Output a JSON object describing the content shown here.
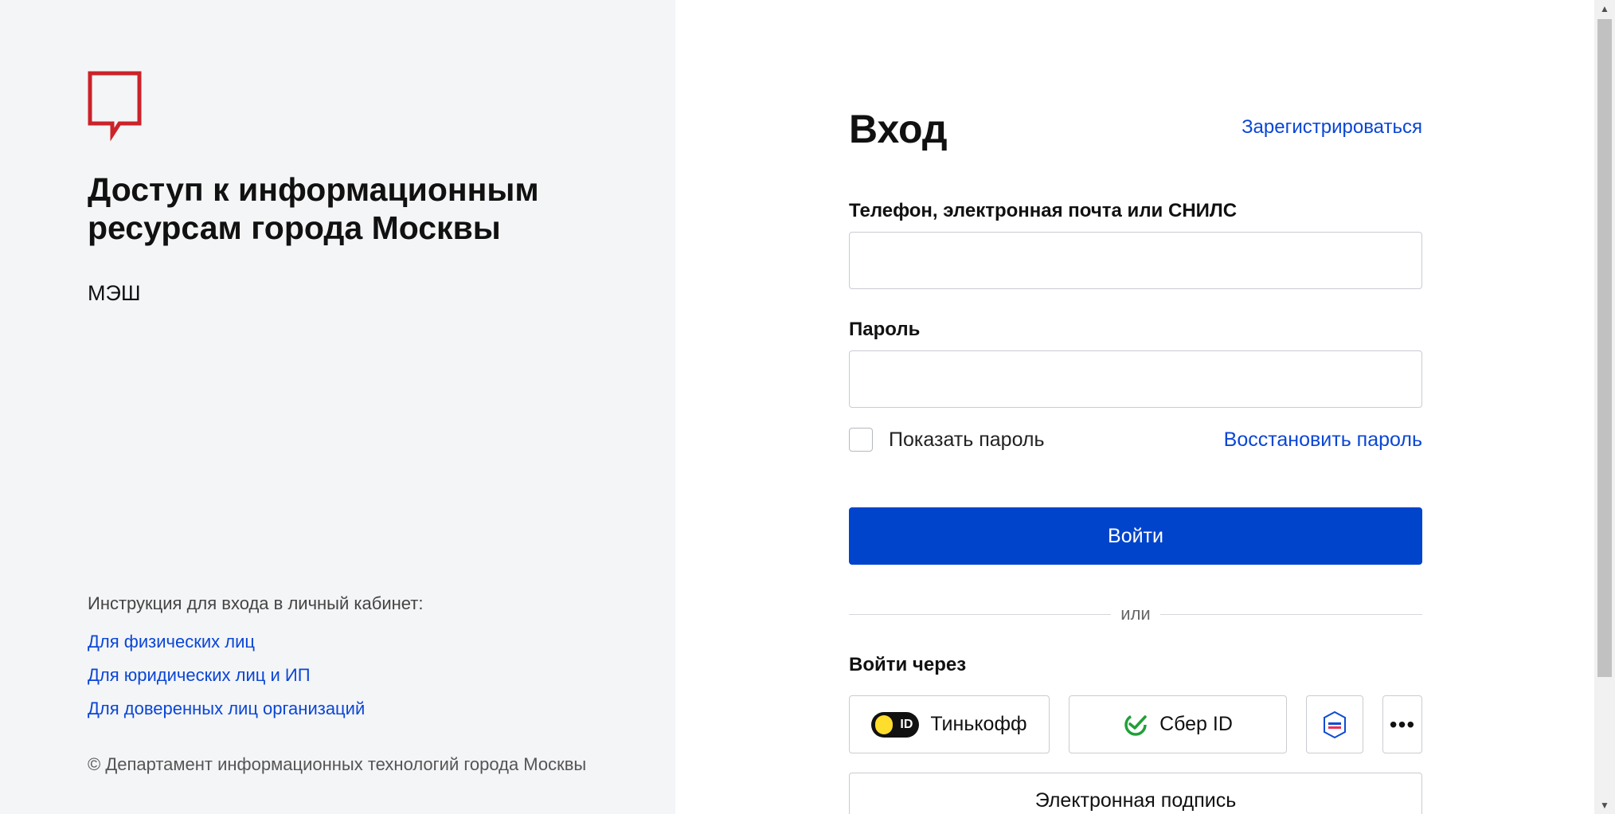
{
  "left_panel": {
    "title": "Доступ к информационным ресурсам города Москвы",
    "service_name": "МЭШ",
    "instructions_title": "Инструкция для входа в личный кабинет:",
    "links": [
      "Для физических лиц",
      "Для юридических лиц и ИП",
      "Для доверенных лиц организаций"
    ],
    "copyright": "© Департамент информационных технологий города Москвы"
  },
  "form": {
    "title": "Вход",
    "register_link": "Зарегистрироваться",
    "login_label": "Телефон, электронная почта или СНИЛС",
    "login_value": "",
    "password_label": "Пароль",
    "password_value": "",
    "show_password_label": "Показать пароль",
    "show_password_checked": false,
    "restore_link": "Восстановить пароль",
    "submit_label": "Войти",
    "divider_text": "или",
    "via_title": "Войти через",
    "providers": {
      "tinkoff": "Тинькофф",
      "tinkoff_badge": "ID",
      "sber": "Сбер ID",
      "more": "•••"
    },
    "esign_label": "Электронная подпись"
  },
  "colors": {
    "accent": "#0044cc",
    "link": "#0a46d6",
    "logo_red": "#cc2229",
    "left_bg": "#f4f5f7"
  },
  "icons": {
    "logo": "moscow-speech-bubble-logo",
    "tinkoff": "tinkoff-id-icon",
    "sber": "sber-id-icon",
    "gosuslugi": "gosuslugi-icon",
    "more": "more-dots-icon"
  }
}
